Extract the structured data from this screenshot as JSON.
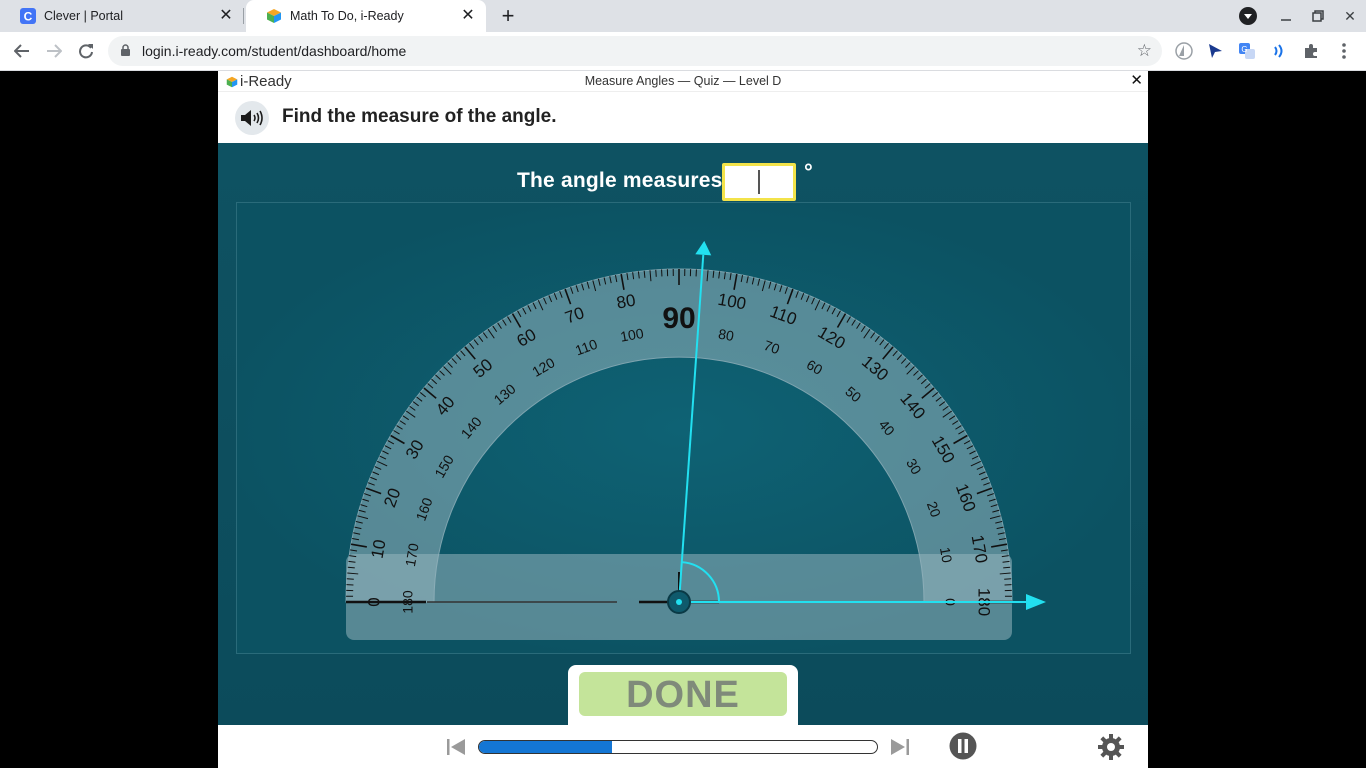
{
  "browser": {
    "tabs": [
      {
        "title": "Clever | Portal",
        "favicon": "clever-logo-icon",
        "active": false
      },
      {
        "title": "Math To Do, i-Ready",
        "favicon": "iready-cube-icon",
        "active": true
      }
    ],
    "url": "login.i-ready.com/student/dashboard/home"
  },
  "app": {
    "brand": "i-Ready",
    "title": "Measure Angles — Quiz — Level D",
    "close": "✕",
    "prompt": "Find the measure of the angle.",
    "answer_label": "The angle measures",
    "answer_value": "",
    "degree_symbol": "°",
    "done_label": "DONE",
    "progress_fraction": 0.335
  },
  "protractor": {
    "center_label": "90",
    "outer_labels": [
      "0",
      "10",
      "20",
      "30",
      "40",
      "50",
      "60",
      "70",
      "80",
      "100",
      "110",
      "120",
      "130",
      "140",
      "150",
      "160",
      "170",
      "180"
    ],
    "inner_labels": [
      "180",
      "170",
      "160",
      "150",
      "140",
      "130",
      "120",
      "110",
      "100",
      "80",
      "70",
      "60",
      "50",
      "40",
      "30",
      "20",
      "10",
      "0"
    ],
    "ray_angle_deg": 86
  },
  "colors": {
    "accent_cyan": "#22e0f0",
    "answer_border": "#f3e34a",
    "done_bg": "#c4e49a",
    "progress_fill": "#1476d4"
  }
}
